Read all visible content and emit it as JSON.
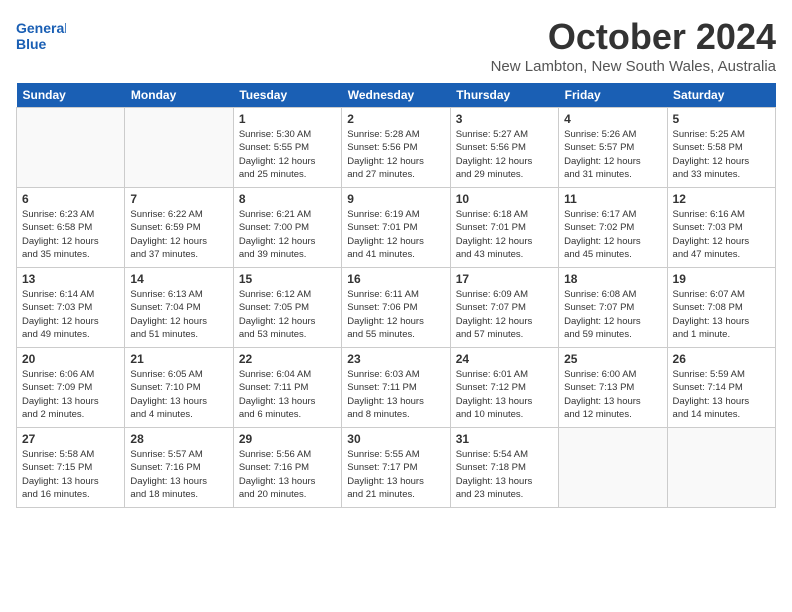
{
  "logo": {
    "line1": "General",
    "line2": "Blue"
  },
  "title": "October 2024",
  "location": "New Lambton, New South Wales, Australia",
  "days_header": [
    "Sunday",
    "Monday",
    "Tuesday",
    "Wednesday",
    "Thursday",
    "Friday",
    "Saturday"
  ],
  "weeks": [
    [
      {
        "day": "",
        "info": ""
      },
      {
        "day": "",
        "info": ""
      },
      {
        "day": "1",
        "info": "Sunrise: 5:30 AM\nSunset: 5:55 PM\nDaylight: 12 hours\nand 25 minutes."
      },
      {
        "day": "2",
        "info": "Sunrise: 5:28 AM\nSunset: 5:56 PM\nDaylight: 12 hours\nand 27 minutes."
      },
      {
        "day": "3",
        "info": "Sunrise: 5:27 AM\nSunset: 5:56 PM\nDaylight: 12 hours\nand 29 minutes."
      },
      {
        "day": "4",
        "info": "Sunrise: 5:26 AM\nSunset: 5:57 PM\nDaylight: 12 hours\nand 31 minutes."
      },
      {
        "day": "5",
        "info": "Sunrise: 5:25 AM\nSunset: 5:58 PM\nDaylight: 12 hours\nand 33 minutes."
      }
    ],
    [
      {
        "day": "6",
        "info": "Sunrise: 6:23 AM\nSunset: 6:58 PM\nDaylight: 12 hours\nand 35 minutes."
      },
      {
        "day": "7",
        "info": "Sunrise: 6:22 AM\nSunset: 6:59 PM\nDaylight: 12 hours\nand 37 minutes."
      },
      {
        "day": "8",
        "info": "Sunrise: 6:21 AM\nSunset: 7:00 PM\nDaylight: 12 hours\nand 39 minutes."
      },
      {
        "day": "9",
        "info": "Sunrise: 6:19 AM\nSunset: 7:01 PM\nDaylight: 12 hours\nand 41 minutes."
      },
      {
        "day": "10",
        "info": "Sunrise: 6:18 AM\nSunset: 7:01 PM\nDaylight: 12 hours\nand 43 minutes."
      },
      {
        "day": "11",
        "info": "Sunrise: 6:17 AM\nSunset: 7:02 PM\nDaylight: 12 hours\nand 45 minutes."
      },
      {
        "day": "12",
        "info": "Sunrise: 6:16 AM\nSunset: 7:03 PM\nDaylight: 12 hours\nand 47 minutes."
      }
    ],
    [
      {
        "day": "13",
        "info": "Sunrise: 6:14 AM\nSunset: 7:03 PM\nDaylight: 12 hours\nand 49 minutes."
      },
      {
        "day": "14",
        "info": "Sunrise: 6:13 AM\nSunset: 7:04 PM\nDaylight: 12 hours\nand 51 minutes."
      },
      {
        "day": "15",
        "info": "Sunrise: 6:12 AM\nSunset: 7:05 PM\nDaylight: 12 hours\nand 53 minutes."
      },
      {
        "day": "16",
        "info": "Sunrise: 6:11 AM\nSunset: 7:06 PM\nDaylight: 12 hours\nand 55 minutes."
      },
      {
        "day": "17",
        "info": "Sunrise: 6:09 AM\nSunset: 7:07 PM\nDaylight: 12 hours\nand 57 minutes."
      },
      {
        "day": "18",
        "info": "Sunrise: 6:08 AM\nSunset: 7:07 PM\nDaylight: 12 hours\nand 59 minutes."
      },
      {
        "day": "19",
        "info": "Sunrise: 6:07 AM\nSunset: 7:08 PM\nDaylight: 13 hours\nand 1 minute."
      }
    ],
    [
      {
        "day": "20",
        "info": "Sunrise: 6:06 AM\nSunset: 7:09 PM\nDaylight: 13 hours\nand 2 minutes."
      },
      {
        "day": "21",
        "info": "Sunrise: 6:05 AM\nSunset: 7:10 PM\nDaylight: 13 hours\nand 4 minutes."
      },
      {
        "day": "22",
        "info": "Sunrise: 6:04 AM\nSunset: 7:11 PM\nDaylight: 13 hours\nand 6 minutes."
      },
      {
        "day": "23",
        "info": "Sunrise: 6:03 AM\nSunset: 7:11 PM\nDaylight: 13 hours\nand 8 minutes."
      },
      {
        "day": "24",
        "info": "Sunrise: 6:01 AM\nSunset: 7:12 PM\nDaylight: 13 hours\nand 10 minutes."
      },
      {
        "day": "25",
        "info": "Sunrise: 6:00 AM\nSunset: 7:13 PM\nDaylight: 13 hours\nand 12 minutes."
      },
      {
        "day": "26",
        "info": "Sunrise: 5:59 AM\nSunset: 7:14 PM\nDaylight: 13 hours\nand 14 minutes."
      }
    ],
    [
      {
        "day": "27",
        "info": "Sunrise: 5:58 AM\nSunset: 7:15 PM\nDaylight: 13 hours\nand 16 minutes."
      },
      {
        "day": "28",
        "info": "Sunrise: 5:57 AM\nSunset: 7:16 PM\nDaylight: 13 hours\nand 18 minutes."
      },
      {
        "day": "29",
        "info": "Sunrise: 5:56 AM\nSunset: 7:16 PM\nDaylight: 13 hours\nand 20 minutes."
      },
      {
        "day": "30",
        "info": "Sunrise: 5:55 AM\nSunset: 7:17 PM\nDaylight: 13 hours\nand 21 minutes."
      },
      {
        "day": "31",
        "info": "Sunrise: 5:54 AM\nSunset: 7:18 PM\nDaylight: 13 hours\nand 23 minutes."
      },
      {
        "day": "",
        "info": ""
      },
      {
        "day": "",
        "info": ""
      }
    ]
  ]
}
